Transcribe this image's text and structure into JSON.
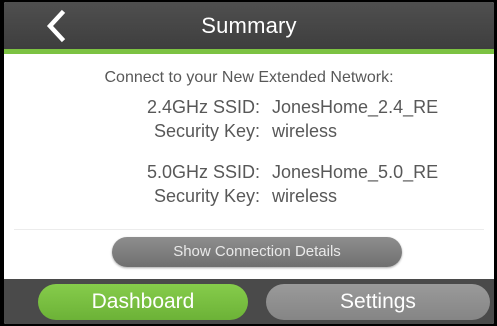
{
  "header": {
    "title": "Summary",
    "back_icon": "chevron-left-icon"
  },
  "summary": {
    "intro": "Connect to your New Extended Network:",
    "networks": [
      {
        "ssid_label": "2.4GHz SSID:",
        "ssid_value": "JonesHome_2.4_RE",
        "key_label": "Security Key:",
        "key_value": "wireless"
      },
      {
        "ssid_label": "5.0GHz SSID:",
        "ssid_value": "JonesHome_5.0_RE",
        "key_label": "Security Key:",
        "key_value": "wireless"
      }
    ],
    "details_button": "Show Connection Details"
  },
  "footer": {
    "dashboard_label": "Dashboard",
    "settings_label": "Settings"
  },
  "colors": {
    "header_bg": "#474747",
    "accent_green": "#7cc242",
    "dashboard_green": "#78bf41",
    "footer_bg": "#4a4a4a",
    "button_gray": "#8a8a8a",
    "text_gray": "#585858"
  }
}
